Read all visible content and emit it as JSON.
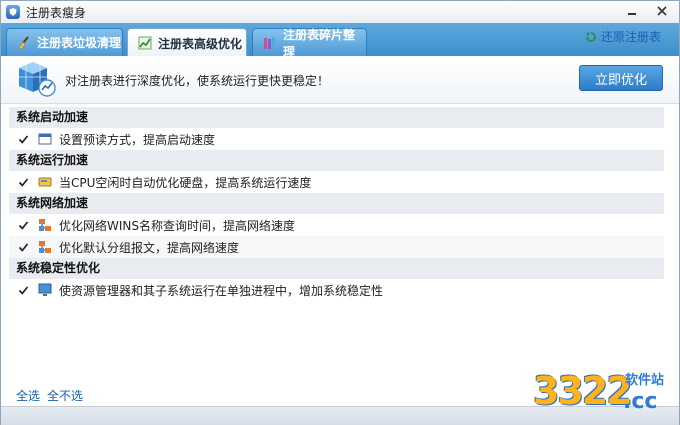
{
  "window": {
    "title": "注册表瘦身"
  },
  "tabs": [
    {
      "label": "注册表垃圾清理",
      "icon": "broom-icon"
    },
    {
      "label": "注册表高级优化",
      "icon": "chart-icon",
      "active": true
    },
    {
      "label": "注册表碎片整理",
      "icon": "books-icon"
    }
  ],
  "restore_label": "还原注册表",
  "header": {
    "description": "对注册表进行深度优化，使系统运行更快更稳定！",
    "optimize_button": "立即优化"
  },
  "sections": [
    {
      "title": "系统启动加速",
      "items": [
        {
          "label": "设置预读方式，提高启动速度",
          "checked": true,
          "icon": "window-icon"
        }
      ]
    },
    {
      "title": "系统运行加速",
      "items": [
        {
          "label": "当CPU空闲时自动优化硬盘，提高系统运行速度",
          "checked": true,
          "icon": "disk-icon"
        }
      ]
    },
    {
      "title": "系统网络加速",
      "items": [
        {
          "label": "优化网络WINS名称查询时间，提高网络速度",
          "checked": true,
          "icon": "network-icon"
        },
        {
          "label": "优化默认分组报文，提高网络速度",
          "checked": true,
          "icon": "network-icon"
        }
      ]
    },
    {
      "title": "系统稳定性优化",
      "items": [
        {
          "label": "使资源管理器和其子系统运行在单独进程中，增加系统稳定性",
          "checked": true,
          "icon": "monitor-icon"
        }
      ]
    }
  ],
  "footer": {
    "select_all": "全选",
    "select_none": "全不选"
  },
  "watermark": {
    "number": "3322",
    "domain": ".cc",
    "site": "软件站"
  },
  "colors": {
    "accent": "#3c8fcd",
    "link": "#1b5fb3",
    "section_bg": "#e8ecf0"
  }
}
